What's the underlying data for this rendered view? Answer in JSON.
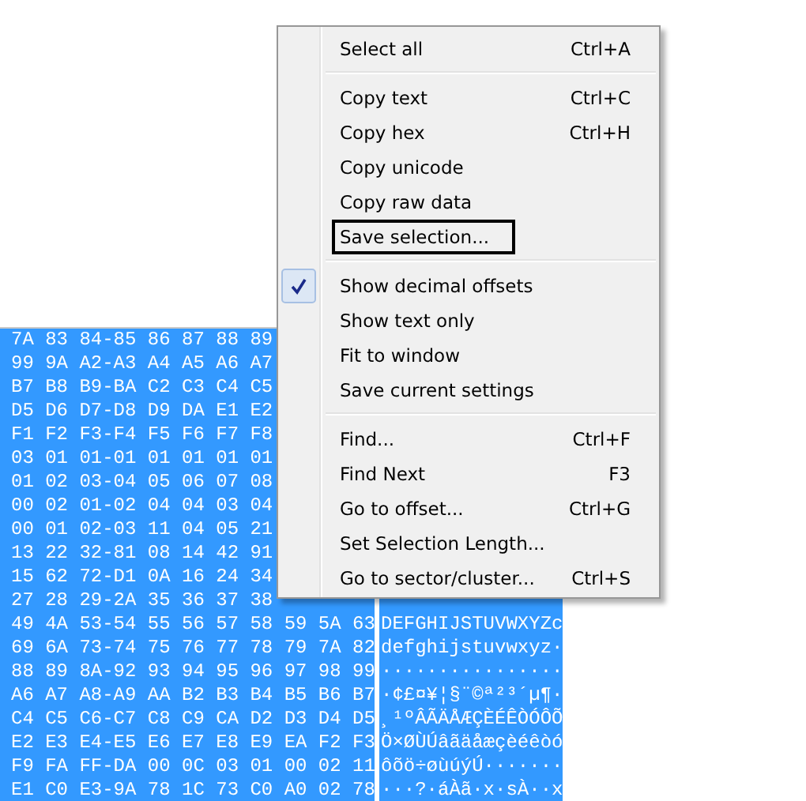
{
  "hex_view": {
    "rows": [
      {
        "hex": "7A 83 84-85 86 87 88 89"
      },
      {
        "hex": "99 9A A2-A3 A4 A5 A6 A7"
      },
      {
        "hex": "B7 B8 B9-BA C2 C3 C4 C5"
      },
      {
        "hex": "D5 D6 D7-D8 D9 DA E1 E2"
      },
      {
        "hex": "F1 F2 F3-F4 F5 F6 F7 F8"
      },
      {
        "hex": "03 01 01-01 01 01 01 01"
      },
      {
        "hex": "01 02 03-04 05 06 07 08"
      },
      {
        "hex": "00 02 01-02 04 04 03 04"
      },
      {
        "hex": "00 01 02-03 11 04 05 21"
      },
      {
        "hex": "13 22 32-81 08 14 42 91"
      },
      {
        "hex": "15 62 72-D1 0A 16 24 34"
      },
      {
        "hex": "27 28 29-2A 35 36 37 38"
      },
      {
        "hex": "49 4A 53-54 55 56 57 58 59 5A 63",
        "text": "DEFGHIJSTUVWXYZc"
      },
      {
        "hex": "69 6A 73-74 75 76 77 78 79 7A 82",
        "text": "defghijstuvwxyz·"
      },
      {
        "hex": "88 89 8A-92 93 94 95 96 97 98 99",
        "text": "················"
      },
      {
        "hex": "A6 A7 A8-A9 AA B2 B3 B4 B5 B6 B7",
        "text": "·¢£¤¥¦§¨©ª²³´µ¶·"
      },
      {
        "hex": "C4 C5 C6-C7 C8 C9 CA D2 D3 D4 D5",
        "text": "¸¹ºÂÃÄÅÆÇÈÉÊÒÓÔÕ"
      },
      {
        "hex": "E2 E3 E4-E5 E6 E7 E8 E9 EA F2 F3",
        "text": "Ö×ØÙÚâãäåæçèéêòó"
      },
      {
        "hex": "F9 FA FF-DA 00 0C 03 01 00 02 11",
        "text": "ôõö÷øùúýÚ·······"
      },
      {
        "hex": "E1 C0 E3-9A 78 1C 73 C0 A0 02 78",
        "text": "···?·áÀã·x·sÀ··x"
      }
    ]
  },
  "context_menu": {
    "groups": [
      [
        {
          "label": "Select all",
          "shortcut": "Ctrl+A",
          "checked": false,
          "selected": false
        }
      ],
      [
        {
          "label": "Copy text",
          "shortcut": "Ctrl+C",
          "checked": false,
          "selected": false
        },
        {
          "label": "Copy hex",
          "shortcut": "Ctrl+H",
          "checked": false,
          "selected": false
        },
        {
          "label": "Copy unicode",
          "checked": false,
          "selected": false
        },
        {
          "label": "Copy raw data",
          "checked": false,
          "selected": false
        },
        {
          "label": "Save selection...",
          "checked": false,
          "selected": true
        }
      ],
      [
        {
          "label": "Show decimal offsets",
          "checked": true,
          "selected": false
        },
        {
          "label": "Show text only",
          "checked": false,
          "selected": false
        },
        {
          "label": "Fit to window",
          "checked": false,
          "selected": false
        },
        {
          "label": "Save current settings",
          "checked": false,
          "selected": false
        }
      ],
      [
        {
          "label": "Find...",
          "shortcut": "Ctrl+F",
          "checked": false,
          "selected": false
        },
        {
          "label": "Find Next",
          "shortcut": "F3",
          "checked": false,
          "selected": false
        },
        {
          "label": "Go to offset...",
          "shortcut": "Ctrl+G",
          "checked": false,
          "selected": false
        },
        {
          "label": "Set Selection Length...",
          "checked": false,
          "selected": false
        },
        {
          "label": "Go to sector/cluster...",
          "shortcut": "Ctrl+S",
          "checked": false,
          "selected": false
        }
      ]
    ]
  }
}
